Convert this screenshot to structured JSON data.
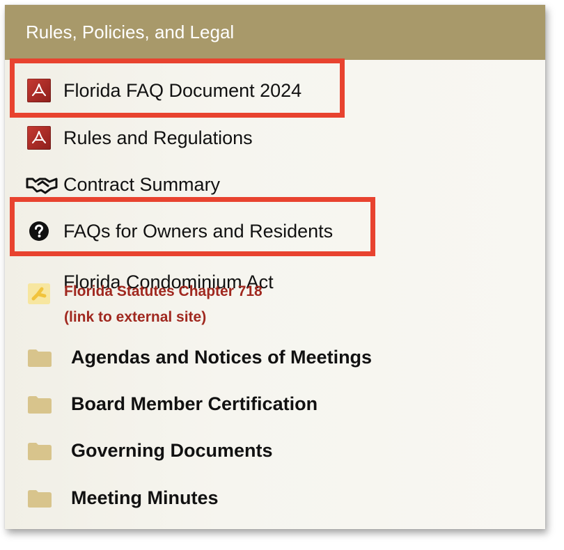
{
  "panel": {
    "title": "Rules, Policies, and Legal",
    "colors": {
      "header_bg": "#a8996a",
      "highlight": "#e8432f",
      "link": "#a0281f",
      "folder": "#d8c48c"
    }
  },
  "items": [
    {
      "label": "Florida FAQ Document 2024",
      "icon": "pdf-icon",
      "highlighted": true
    },
    {
      "label": "Rules and Regulations",
      "icon": "pdf-icon",
      "highlighted": false
    },
    {
      "label": "Contract Summary",
      "icon": "handshake-icon",
      "highlighted": false
    },
    {
      "label": "FAQs for Owners and Residents",
      "icon": "question-circle-icon",
      "highlighted": true
    },
    {
      "label": "Florida Condominium Act",
      "icon": "sun-icon",
      "highlighted": false,
      "sublinks": [
        "Florida Statutes Chapter 718",
        "(link to external site)"
      ]
    }
  ],
  "folders": [
    {
      "label": "Agendas and Notices of Meetings",
      "icon": "folder-icon"
    },
    {
      "label": "Board Member Certification",
      "icon": "folder-icon"
    },
    {
      "label": "Governing Documents",
      "icon": "folder-icon"
    },
    {
      "label": "Meeting Minutes",
      "icon": "folder-icon"
    }
  ]
}
